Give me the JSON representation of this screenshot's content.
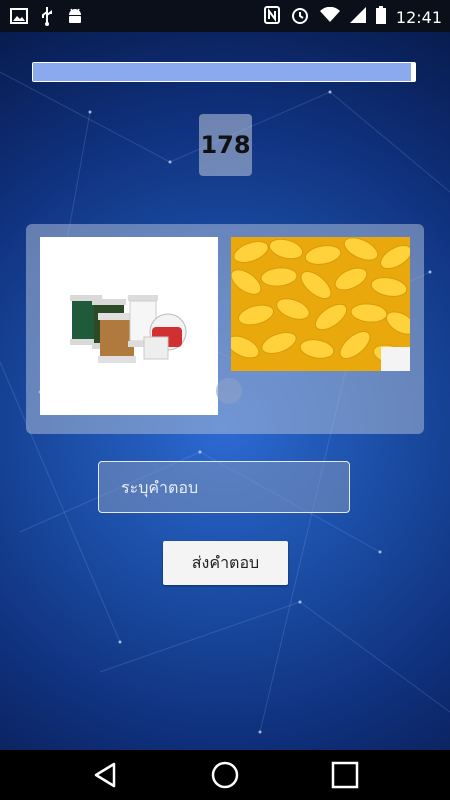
{
  "status_bar": {
    "time": "12:41",
    "left_icons": [
      "image-icon",
      "usb-icon",
      "android-icon"
    ],
    "right_icons": [
      "nfc-icon",
      "alarm-icon",
      "wifi-icon",
      "signal-icon",
      "battery-icon"
    ]
  },
  "quiz": {
    "progress_fraction": 0.99,
    "counter": "178",
    "images": [
      {
        "name": "thread-spools-image",
        "depicts": "thread spools"
      },
      {
        "name": "silk-cocoons-image",
        "depicts": "yellow silk cocoons"
      }
    ],
    "answer_placeholder": "ระบุคำตอบ",
    "answer_value": "",
    "submit_label": "ส่งคำตอบ"
  },
  "nav_bar": {
    "buttons": [
      "back-icon",
      "home-icon",
      "recents-icon"
    ]
  },
  "colors": {
    "background_center": "#2d6ad2",
    "background_edge": "#081c4e",
    "progress_fill": "#8aa9ef",
    "cocoon_yellow": "#f3b712"
  }
}
